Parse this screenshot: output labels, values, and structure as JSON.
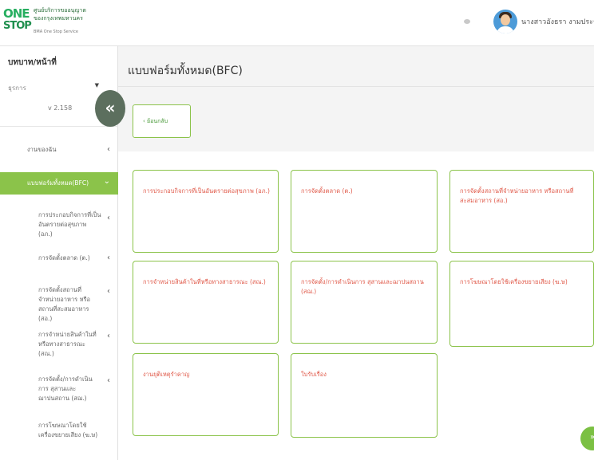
{
  "header": {
    "logo_one": "ONE",
    "logo_stop": "STOP",
    "logo_line1": "ศูนย์บริการขออนุญาต",
    "logo_line2": "ของกรุงเทพมหานคร",
    "logo_sub": "BMA One Stop Service",
    "user_name": "นางสาวอังธรา งามประชา"
  },
  "sidebar": {
    "title": "บทบาท/หน้าที่",
    "role_value": "ธุรการ",
    "role_caret": "▼",
    "version": "v 2.158",
    "collapse_label": "«",
    "items": [
      {
        "label": "งานของฉัน",
        "chev": "‹"
      },
      {
        "label": "แบบฟอร์มทั้งหมด(BFC)",
        "chev": "⌄"
      },
      {
        "label": "การประกอบกิจการที่เป็นอันตรายต่อสุขภาพ (อภ.)",
        "chev": "‹"
      },
      {
        "label": "การจัดตั้งตลาด (ต.)",
        "chev": "‹"
      },
      {
        "label": "การจัดตั้งสถานที่จำหน่ายอาหาร หรือสถานที่สะสมอาหาร (สอ.)",
        "chev": "‹"
      },
      {
        "label": "การจำหน่ายสินค้าในที่หรือทางสาธารณะ (สณ.)",
        "chev": "‹"
      },
      {
        "label": "การจัดตั้ง/การดำเนินการ สุสานและฌาปนสถาน (สฌ.)",
        "chev": "‹"
      },
      {
        "label": "การโฆษณาโดยใช้เครื่องขยายเสียง (ฆ.ษ)",
        "chev": ""
      }
    ]
  },
  "main": {
    "page_title": "แบบฟอร์มทั้งหมด(BFC)",
    "back_label": "‹  ย้อนกลับ",
    "cards": [
      {
        "label": "การประกอบกิจการที่เป็นอันตรายต่อสุขภาพ (อภ.)"
      },
      {
        "label": "การจัดตั้งตลาด (ต.)"
      },
      {
        "label": "การจัดตั้งสถานที่จำหน่ายอาหาร หรือสถานที่สะสมอาหาร (สอ.)"
      },
      {
        "label": "การจำหน่ายสินค้าในที่หรือทางสาธารณะ (สณ.)"
      },
      {
        "label": "การจัดตั้ง/การดำเนินการ สุสานและฌาปนสถาน (สฌ.)"
      },
      {
        "label": "การโฆษณาโดยใช้เครื่องขยายเสียง (ฆ.ษ)"
      },
      {
        "label": "งานยุติเหตุรำคาญ"
      },
      {
        "label": "ใบรับเรื่อง"
      }
    ],
    "fab_label": "»"
  },
  "colors": {
    "accent_green": "#8bc34a",
    "card_text": "#e05a4a",
    "collapse_bg": "#5c6f5e"
  }
}
